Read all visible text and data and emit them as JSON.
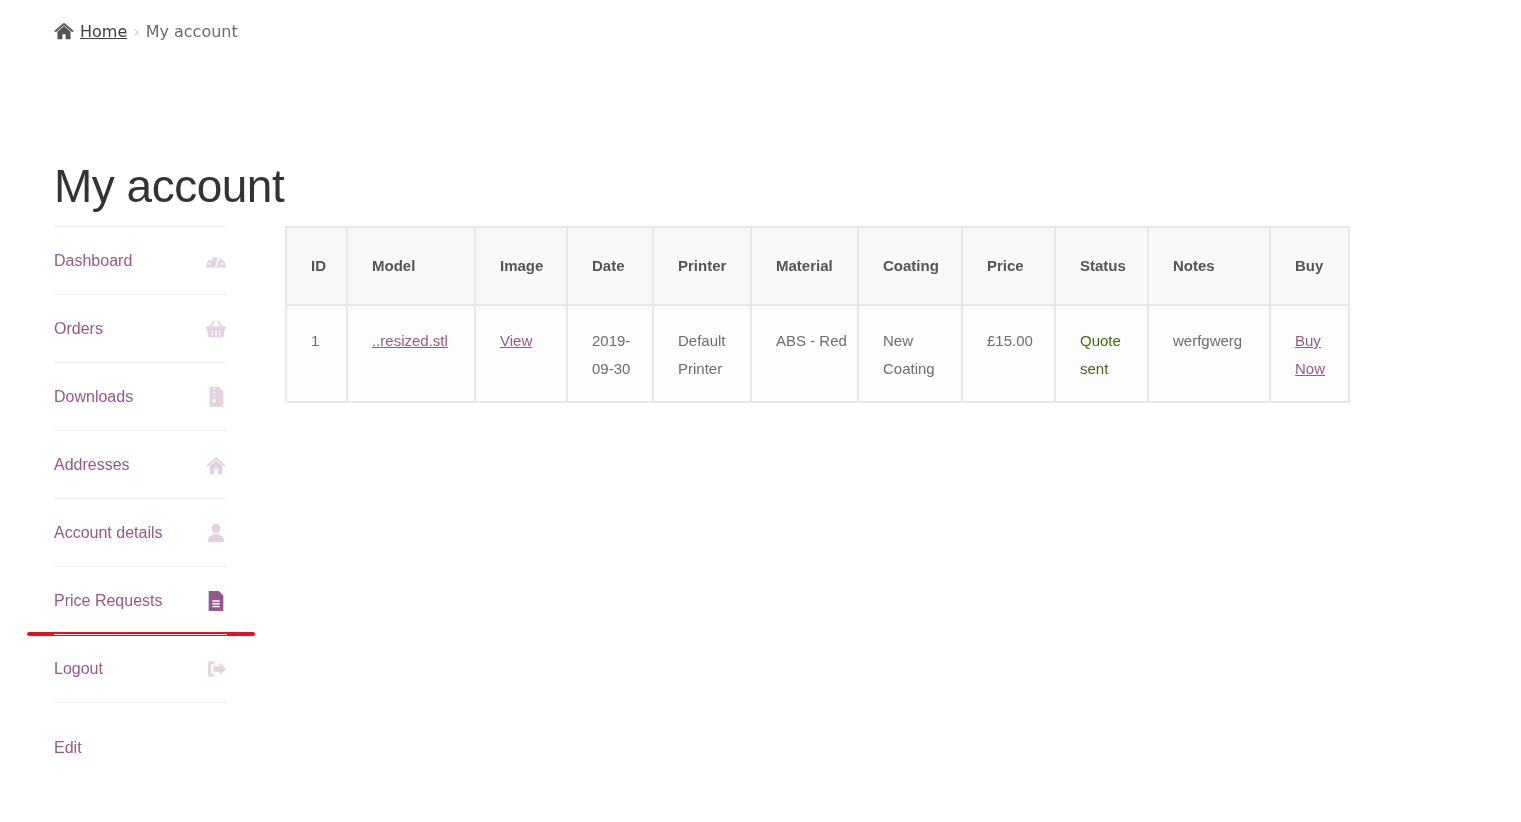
{
  "breadcrumb": {
    "home": "Home",
    "separator": "›",
    "current": "My account"
  },
  "title": "My account",
  "sidebar": {
    "items": [
      {
        "label": "Dashboard",
        "selected": false
      },
      {
        "label": "Orders",
        "selected": false
      },
      {
        "label": "Downloads",
        "selected": false
      },
      {
        "label": "Addresses",
        "selected": false
      },
      {
        "label": "Account details",
        "selected": false
      },
      {
        "label": "Price Requests",
        "selected": true,
        "marked": true
      },
      {
        "label": "Logout",
        "selected": false
      },
      {
        "label": "Edit"
      }
    ]
  },
  "table": {
    "columns": [
      "ID",
      "Model",
      "Image",
      "Date",
      "Printer",
      "Material",
      "Coating",
      "Price",
      "Status",
      "Notes",
      "Buy"
    ],
    "rows": [
      {
        "cells": [
          {
            "kind": "text",
            "text": "1"
          },
          {
            "kind": "link",
            "text": "..resized.stl"
          },
          {
            "kind": "link",
            "text": "View"
          },
          {
            "kind": "text",
            "text": "2019-09-30"
          },
          {
            "kind": "text",
            "text": "Default Printer"
          },
          {
            "kind": "text",
            "text": "ABS - Red"
          },
          {
            "kind": "text",
            "text": "New Coating"
          },
          {
            "kind": "text",
            "text": "£15.00"
          },
          {
            "kind": "status",
            "text": "Quote sent"
          },
          {
            "kind": "text",
            "text": "werfgwerg"
          },
          {
            "kind": "link",
            "text": "Buy Now"
          }
        ]
      }
    ]
  }
}
